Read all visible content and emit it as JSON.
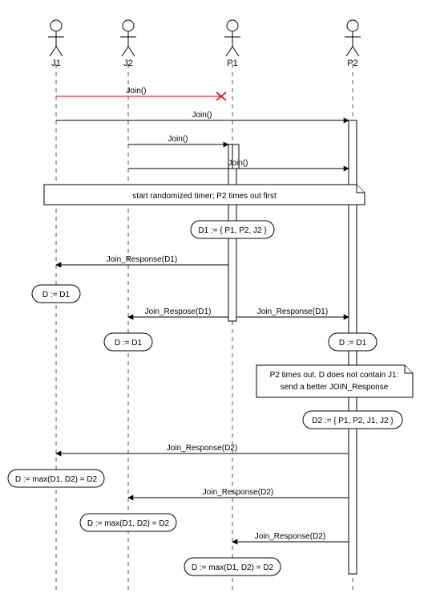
{
  "actors": {
    "j1": "J1",
    "j2": "J2",
    "p1": "P1",
    "p2": "P2"
  },
  "messages": {
    "join_j1_p1_lost": "Join()",
    "join_j1_p2": "Join()",
    "join_j2_p1": "Join()",
    "join_j2_p2": "Join()",
    "jr_p1_j1": "Join_Response(D1)",
    "jr_p1_j2": "Join_Respose(D1)",
    "jr_p1_p2": "Join_Response(D1)",
    "jr_p2_j1": "Join_Response(D2)",
    "jr_p2_j2": "Join_Response(D2)",
    "jr_p2_p1": "Join_Response(D2)"
  },
  "notes": {
    "timer": "start randomized timer; P2 times out first",
    "d1_def": "D1 := { P1, P2, J2 }",
    "d_eq_d1_j1": "D := D1",
    "d_eq_d1_j2": "D := D1",
    "d_eq_d1_p2": "D := D1",
    "p2_timeout_l1": "P2 times out. D does not contain J1:",
    "p2_timeout_l2": "send a better JOIN_Response",
    "d2_def": "D2 := { P1, P2, J1, J2 }",
    "d_max_j1": "D := max(D1, D2) = D2",
    "d_max_j2": "D := max(D1, D2) = D2",
    "d_max_p1": "D := max(D1, D2) = D2"
  },
  "chart_data": {
    "type": "sequence_diagram",
    "actors": [
      "J1",
      "J2",
      "P1",
      "P2"
    ],
    "events": [
      {
        "type": "message",
        "from": "J1",
        "to": "P1",
        "label": "Join()",
        "status": "lost"
      },
      {
        "type": "message",
        "from": "J1",
        "to": "P2",
        "label": "Join()"
      },
      {
        "type": "message",
        "from": "J2",
        "to": "P1",
        "label": "Join()"
      },
      {
        "type": "message",
        "from": "J2",
        "to": "P2",
        "label": "Join()"
      },
      {
        "type": "note",
        "over": [
          "J1",
          "J2",
          "P1",
          "P2"
        ],
        "text": "start randomized timer; P2 times out first"
      },
      {
        "type": "note",
        "over": [
          "P1"
        ],
        "text": "D1 := { P1, P2, J2 }"
      },
      {
        "type": "message",
        "from": "P1",
        "to": "J1",
        "label": "Join_Response(D1)"
      },
      {
        "type": "note",
        "over": [
          "J1"
        ],
        "text": "D := D1"
      },
      {
        "type": "message",
        "from": "P1",
        "to": "J2",
        "label": "Join_Respose(D1)"
      },
      {
        "type": "message",
        "from": "P1",
        "to": "P2",
        "label": "Join_Response(D1)"
      },
      {
        "type": "note",
        "over": [
          "J2"
        ],
        "text": "D := D1"
      },
      {
        "type": "note",
        "over": [
          "P2"
        ],
        "text": "D := D1"
      },
      {
        "type": "note",
        "over": [
          "P2"
        ],
        "text": "P2 times out. D does not contain J1: send a better JOIN_Response"
      },
      {
        "type": "note",
        "over": [
          "P2"
        ],
        "text": "D2 := { P1, P2, J1, J2 }"
      },
      {
        "type": "message",
        "from": "P2",
        "to": "J1",
        "label": "Join_Response(D2)"
      },
      {
        "type": "note",
        "over": [
          "J1"
        ],
        "text": "D := max(D1, D2) = D2"
      },
      {
        "type": "message",
        "from": "P2",
        "to": "J2",
        "label": "Join_Response(D2)"
      },
      {
        "type": "note",
        "over": [
          "J2"
        ],
        "text": "D := max(D1, D2) = D2"
      },
      {
        "type": "message",
        "from": "P2",
        "to": "P1",
        "label": "Join_Response(D2)"
      },
      {
        "type": "note",
        "over": [
          "P1"
        ],
        "text": "D := max(D1, D2) = D2"
      }
    ]
  }
}
